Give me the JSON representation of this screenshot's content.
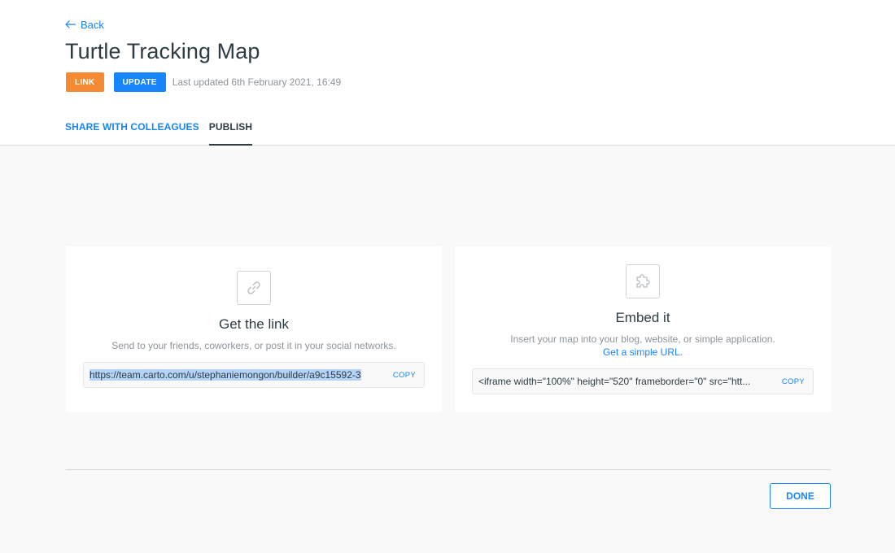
{
  "header": {
    "back_label": "Back",
    "title": "Turtle Tracking Map",
    "badge_link": "LINK",
    "badge_update": "UPDATE",
    "last_updated": "Last updated 6th February 2021, 16:49"
  },
  "tabs": [
    {
      "label": "SHARE WITH COLLEAGUES",
      "active": false
    },
    {
      "label": "PUBLISH",
      "active": true
    }
  ],
  "link_card": {
    "icon": "link-icon",
    "title": "Get the link",
    "description": "Send to your friends, coworkers, or post it in your social networks.",
    "url": "https://team.carto.com/u/stephaniemongon/builder/a9c15592-3",
    "copy_label": "COPY"
  },
  "embed_card": {
    "icon": "puzzle-icon",
    "title": "Embed it",
    "description": "Insert your map into your blog, website, or simple application.",
    "simple_url_label": "Get a simple URL.",
    "embed_code": "<iframe width=\"100%\" height=\"520\" frameborder=\"0\" src=\"htt...",
    "copy_label": "COPY"
  },
  "footer": {
    "done_label": "DONE"
  },
  "colors": {
    "accent": "#1785fb",
    "link_badge": "#f48b32",
    "text": "#2e3c43",
    "muted": "#8d949a"
  }
}
